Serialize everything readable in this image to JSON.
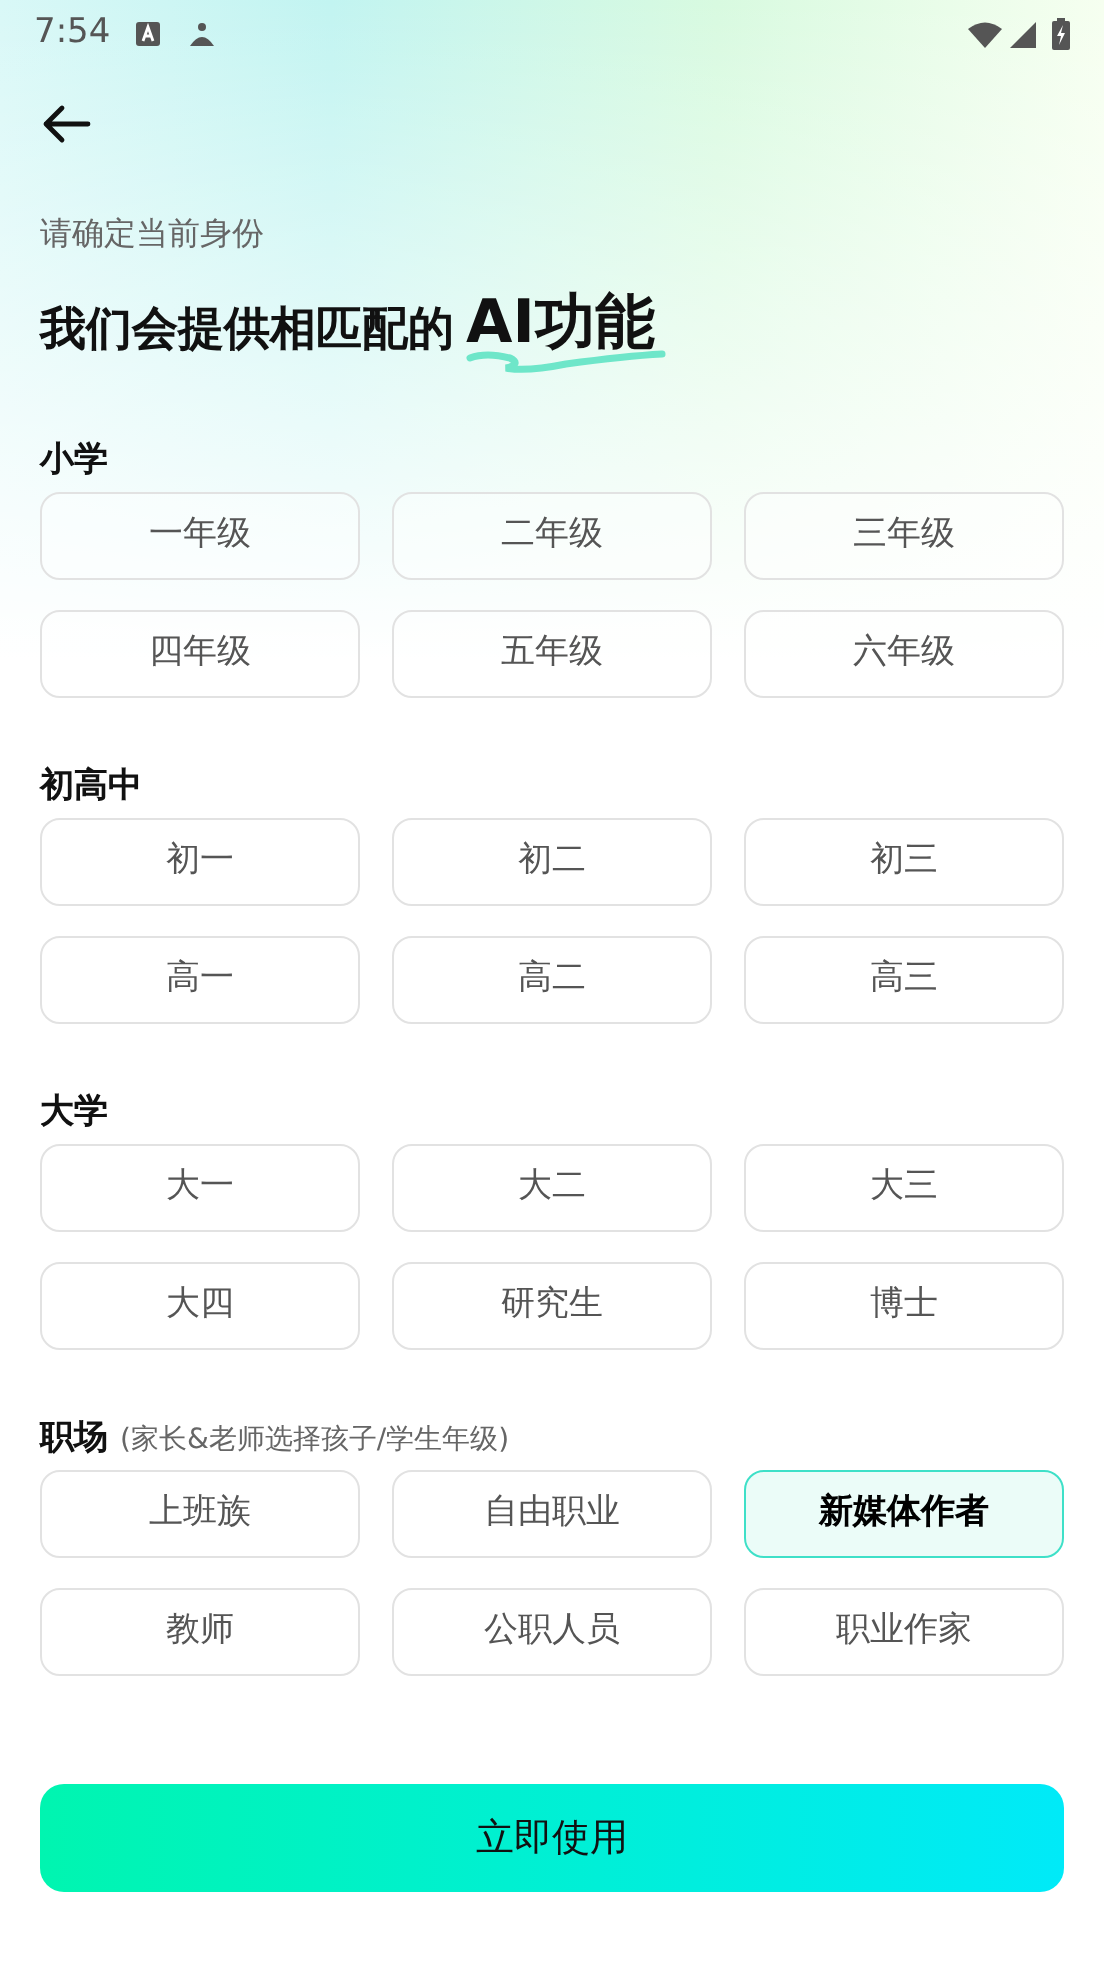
{
  "status_bar": {
    "time": "7:54"
  },
  "subtitle": "请确定当前身份",
  "title": {
    "text": "我们会提供相匹配的",
    "highlight": "AI功能"
  },
  "sections": [
    {
      "title": "小学",
      "options": [
        {
          "label": "一年级",
          "selected": false
        },
        {
          "label": "二年级",
          "selected": false
        },
        {
          "label": "三年级",
          "selected": false
        },
        {
          "label": "四年级",
          "selected": false
        },
        {
          "label": "五年级",
          "selected": false
        },
        {
          "label": "六年级",
          "selected": false
        }
      ]
    },
    {
      "title": "初高中",
      "options": [
        {
          "label": "初一",
          "selected": false
        },
        {
          "label": "初二",
          "selected": false
        },
        {
          "label": "初三",
          "selected": false
        },
        {
          "label": "高一",
          "selected": false
        },
        {
          "label": "高二",
          "selected": false
        },
        {
          "label": "高三",
          "selected": false
        }
      ]
    },
    {
      "title": "大学",
      "options": [
        {
          "label": "大一",
          "selected": false
        },
        {
          "label": "大二",
          "selected": false
        },
        {
          "label": "大三",
          "selected": false
        },
        {
          "label": "大四",
          "selected": false
        },
        {
          "label": "研究生",
          "selected": false
        },
        {
          "label": "博士",
          "selected": false
        }
      ]
    },
    {
      "title": "职场",
      "note": "(家长&老师选择孩子/学生年级)",
      "options": [
        {
          "label": "上班族",
          "selected": false
        },
        {
          "label": "自由职业",
          "selected": false
        },
        {
          "label": "新媒体作者",
          "selected": true
        },
        {
          "label": "教师",
          "selected": false
        },
        {
          "label": "公职人员",
          "selected": false
        },
        {
          "label": "职业作家",
          "selected": false
        }
      ]
    }
  ],
  "submit_button": "立即使用"
}
